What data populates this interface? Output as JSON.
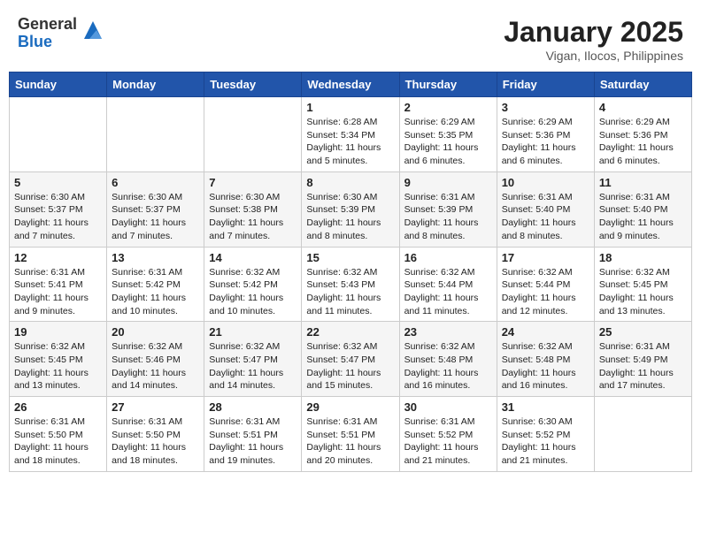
{
  "logo": {
    "general": "General",
    "blue": "Blue"
  },
  "title": "January 2025",
  "location": "Vigan, Ilocos, Philippines",
  "weekdays": [
    "Sunday",
    "Monday",
    "Tuesday",
    "Wednesday",
    "Thursday",
    "Friday",
    "Saturday"
  ],
  "weeks": [
    [
      {
        "day": "",
        "sunrise": "",
        "sunset": "",
        "daylight": ""
      },
      {
        "day": "",
        "sunrise": "",
        "sunset": "",
        "daylight": ""
      },
      {
        "day": "",
        "sunrise": "",
        "sunset": "",
        "daylight": ""
      },
      {
        "day": "1",
        "sunrise": "Sunrise: 6:28 AM",
        "sunset": "Sunset: 5:34 PM",
        "daylight": "Daylight: 11 hours and 5 minutes."
      },
      {
        "day": "2",
        "sunrise": "Sunrise: 6:29 AM",
        "sunset": "Sunset: 5:35 PM",
        "daylight": "Daylight: 11 hours and 6 minutes."
      },
      {
        "day": "3",
        "sunrise": "Sunrise: 6:29 AM",
        "sunset": "Sunset: 5:36 PM",
        "daylight": "Daylight: 11 hours and 6 minutes."
      },
      {
        "day": "4",
        "sunrise": "Sunrise: 6:29 AM",
        "sunset": "Sunset: 5:36 PM",
        "daylight": "Daylight: 11 hours and 6 minutes."
      }
    ],
    [
      {
        "day": "5",
        "sunrise": "Sunrise: 6:30 AM",
        "sunset": "Sunset: 5:37 PM",
        "daylight": "Daylight: 11 hours and 7 minutes."
      },
      {
        "day": "6",
        "sunrise": "Sunrise: 6:30 AM",
        "sunset": "Sunset: 5:37 PM",
        "daylight": "Daylight: 11 hours and 7 minutes."
      },
      {
        "day": "7",
        "sunrise": "Sunrise: 6:30 AM",
        "sunset": "Sunset: 5:38 PM",
        "daylight": "Daylight: 11 hours and 7 minutes."
      },
      {
        "day": "8",
        "sunrise": "Sunrise: 6:30 AM",
        "sunset": "Sunset: 5:39 PM",
        "daylight": "Daylight: 11 hours and 8 minutes."
      },
      {
        "day": "9",
        "sunrise": "Sunrise: 6:31 AM",
        "sunset": "Sunset: 5:39 PM",
        "daylight": "Daylight: 11 hours and 8 minutes."
      },
      {
        "day": "10",
        "sunrise": "Sunrise: 6:31 AM",
        "sunset": "Sunset: 5:40 PM",
        "daylight": "Daylight: 11 hours and 8 minutes."
      },
      {
        "day": "11",
        "sunrise": "Sunrise: 6:31 AM",
        "sunset": "Sunset: 5:40 PM",
        "daylight": "Daylight: 11 hours and 9 minutes."
      }
    ],
    [
      {
        "day": "12",
        "sunrise": "Sunrise: 6:31 AM",
        "sunset": "Sunset: 5:41 PM",
        "daylight": "Daylight: 11 hours and 9 minutes."
      },
      {
        "day": "13",
        "sunrise": "Sunrise: 6:31 AM",
        "sunset": "Sunset: 5:42 PM",
        "daylight": "Daylight: 11 hours and 10 minutes."
      },
      {
        "day": "14",
        "sunrise": "Sunrise: 6:32 AM",
        "sunset": "Sunset: 5:42 PM",
        "daylight": "Daylight: 11 hours and 10 minutes."
      },
      {
        "day": "15",
        "sunrise": "Sunrise: 6:32 AM",
        "sunset": "Sunset: 5:43 PM",
        "daylight": "Daylight: 11 hours and 11 minutes."
      },
      {
        "day": "16",
        "sunrise": "Sunrise: 6:32 AM",
        "sunset": "Sunset: 5:44 PM",
        "daylight": "Daylight: 11 hours and 11 minutes."
      },
      {
        "day": "17",
        "sunrise": "Sunrise: 6:32 AM",
        "sunset": "Sunset: 5:44 PM",
        "daylight": "Daylight: 11 hours and 12 minutes."
      },
      {
        "day": "18",
        "sunrise": "Sunrise: 6:32 AM",
        "sunset": "Sunset: 5:45 PM",
        "daylight": "Daylight: 11 hours and 13 minutes."
      }
    ],
    [
      {
        "day": "19",
        "sunrise": "Sunrise: 6:32 AM",
        "sunset": "Sunset: 5:45 PM",
        "daylight": "Daylight: 11 hours and 13 minutes."
      },
      {
        "day": "20",
        "sunrise": "Sunrise: 6:32 AM",
        "sunset": "Sunset: 5:46 PM",
        "daylight": "Daylight: 11 hours and 14 minutes."
      },
      {
        "day": "21",
        "sunrise": "Sunrise: 6:32 AM",
        "sunset": "Sunset: 5:47 PM",
        "daylight": "Daylight: 11 hours and 14 minutes."
      },
      {
        "day": "22",
        "sunrise": "Sunrise: 6:32 AM",
        "sunset": "Sunset: 5:47 PM",
        "daylight": "Daylight: 11 hours and 15 minutes."
      },
      {
        "day": "23",
        "sunrise": "Sunrise: 6:32 AM",
        "sunset": "Sunset: 5:48 PM",
        "daylight": "Daylight: 11 hours and 16 minutes."
      },
      {
        "day": "24",
        "sunrise": "Sunrise: 6:32 AM",
        "sunset": "Sunset: 5:48 PM",
        "daylight": "Daylight: 11 hours and 16 minutes."
      },
      {
        "day": "25",
        "sunrise": "Sunrise: 6:31 AM",
        "sunset": "Sunset: 5:49 PM",
        "daylight": "Daylight: 11 hours and 17 minutes."
      }
    ],
    [
      {
        "day": "26",
        "sunrise": "Sunrise: 6:31 AM",
        "sunset": "Sunset: 5:50 PM",
        "daylight": "Daylight: 11 hours and 18 minutes."
      },
      {
        "day": "27",
        "sunrise": "Sunrise: 6:31 AM",
        "sunset": "Sunset: 5:50 PM",
        "daylight": "Daylight: 11 hours and 18 minutes."
      },
      {
        "day": "28",
        "sunrise": "Sunrise: 6:31 AM",
        "sunset": "Sunset: 5:51 PM",
        "daylight": "Daylight: 11 hours and 19 minutes."
      },
      {
        "day": "29",
        "sunrise": "Sunrise: 6:31 AM",
        "sunset": "Sunset: 5:51 PM",
        "daylight": "Daylight: 11 hours and 20 minutes."
      },
      {
        "day": "30",
        "sunrise": "Sunrise: 6:31 AM",
        "sunset": "Sunset: 5:52 PM",
        "daylight": "Daylight: 11 hours and 21 minutes."
      },
      {
        "day": "31",
        "sunrise": "Sunrise: 6:30 AM",
        "sunset": "Sunset: 5:52 PM",
        "daylight": "Daylight: 11 hours and 21 minutes."
      },
      {
        "day": "",
        "sunrise": "",
        "sunset": "",
        "daylight": ""
      }
    ]
  ]
}
